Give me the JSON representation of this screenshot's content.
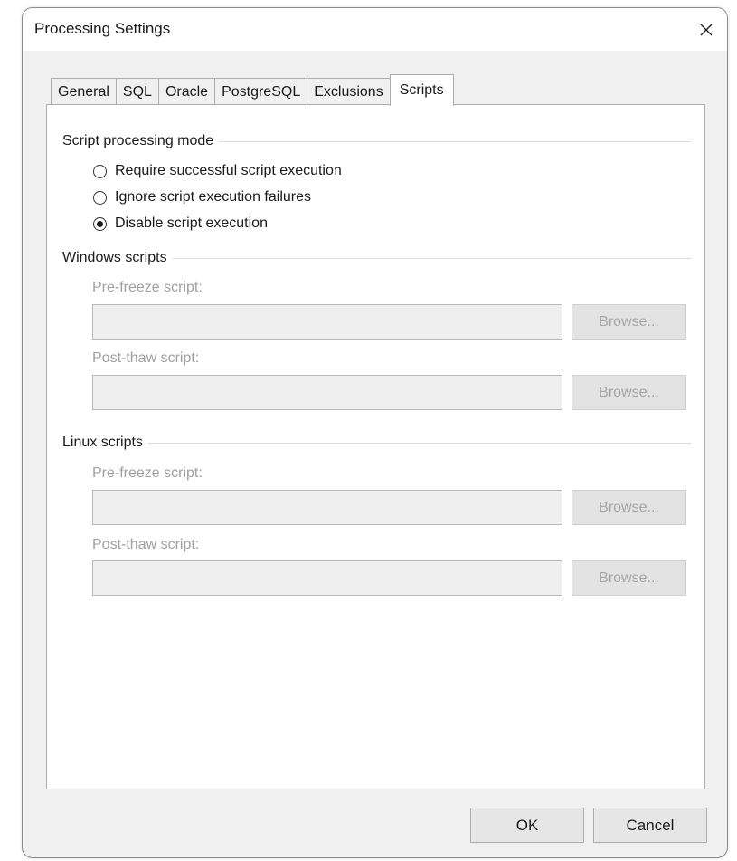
{
  "window": {
    "title": "Processing Settings",
    "close_glyph": "✕"
  },
  "tabs": [
    {
      "label": "General"
    },
    {
      "label": "SQL"
    },
    {
      "label": "Oracle"
    },
    {
      "label": "PostgreSQL"
    },
    {
      "label": "Exclusions"
    },
    {
      "label": "Scripts",
      "active": true
    }
  ],
  "script_mode": {
    "header": "Script processing mode",
    "options": [
      {
        "label": "Require successful script execution",
        "checked": false
      },
      {
        "label": "Ignore script execution failures",
        "checked": false
      },
      {
        "label": "Disable script execution",
        "checked": true
      }
    ]
  },
  "windows_scripts": {
    "header": "Windows scripts",
    "pre_freeze_label": "Pre-freeze script:",
    "pre_freeze_value": "",
    "post_thaw_label": "Post-thaw script:",
    "post_thaw_value": "",
    "browse_label": "Browse..."
  },
  "linux_scripts": {
    "header": "Linux scripts",
    "pre_freeze_label": "Pre-freeze script:",
    "pre_freeze_value": "",
    "post_thaw_label": "Post-thaw script:",
    "post_thaw_value": "",
    "browse_label": "Browse..."
  },
  "footer": {
    "ok_label": "OK",
    "cancel_label": "Cancel"
  }
}
